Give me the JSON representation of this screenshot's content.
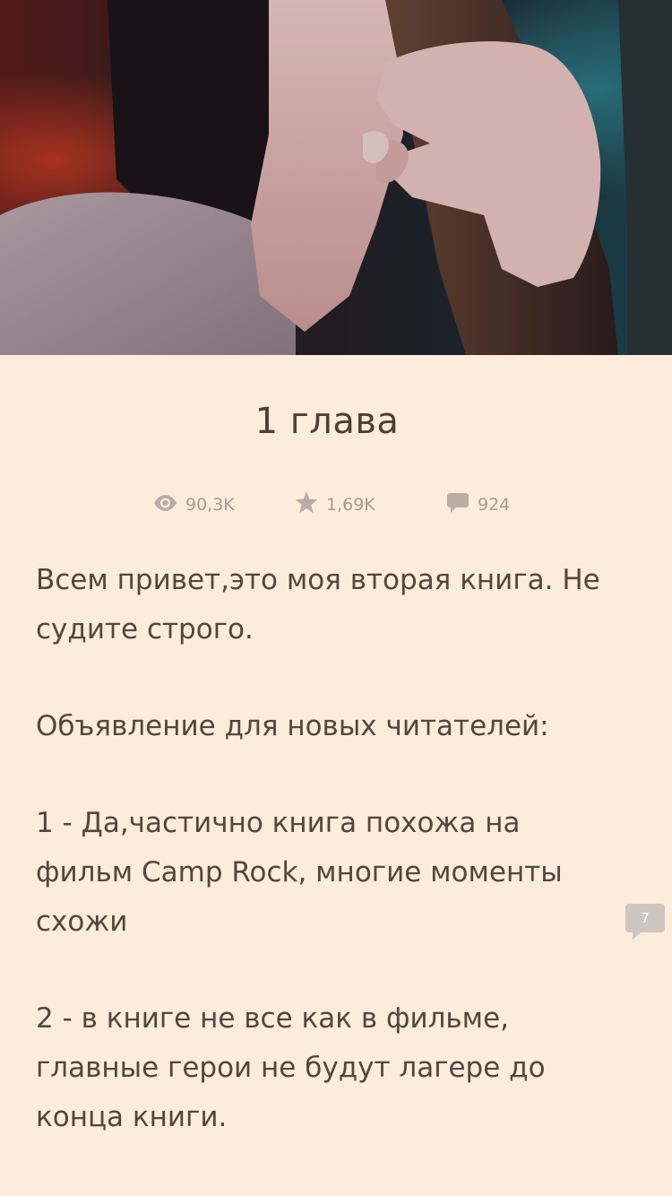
{
  "chapter": {
    "title": "1 глава"
  },
  "stats": {
    "views": {
      "icon": "eye-icon",
      "value": "90,3K"
    },
    "votes": {
      "icon": "star-icon",
      "value": "1,69K"
    },
    "comments": {
      "icon": "comment-icon",
      "value": "924"
    }
  },
  "story": {
    "paragraphs": [
      "Всем привет,это моя вторая книга. Не судите строго.",
      "Объявление для новых читателей:",
      "1 - Да,частично книга похожа на фильм Camp Rock, многие моменты схожи",
      "2 - в книге не все как в фильме, главные герои не будут лагере до конца книги."
    ]
  },
  "inline_comment": {
    "count": "7"
  },
  "colors": {
    "background": "#fcecdc",
    "text": "#54463b",
    "muted": "#a89a90"
  }
}
